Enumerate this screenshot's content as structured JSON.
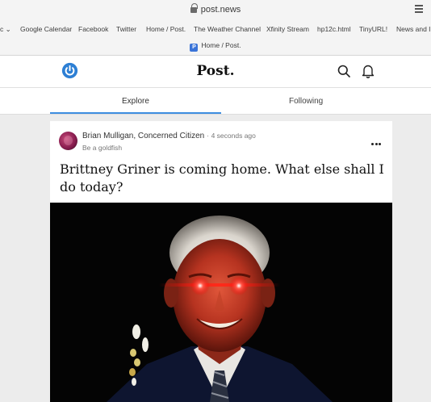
{
  "browser": {
    "url": "post.news",
    "bookmarks": [
      "c ⌄",
      "Google Calendar",
      "Facebook",
      "Twitter",
      "Home / Post.",
      "The Weather Channel",
      "Xfinity Stream",
      "hp12c.html",
      "TinyURL!",
      "News and In"
    ],
    "tab_title": "Home / Post.",
    "tab_favicon": "P"
  },
  "header": {
    "brand": "Post.",
    "left_icon": "power-icon",
    "right_icons": [
      "search-icon",
      "bell-icon"
    ],
    "accent": "#2d7fd4"
  },
  "tabs": [
    {
      "label": "Explore",
      "active": true
    },
    {
      "label": "Following",
      "active": false
    }
  ],
  "post": {
    "author": "Brian Mulligan, Concerned Citizen",
    "separator": "·",
    "time": "4 seconds ago",
    "bio": "Be a goldfish",
    "text": "Brittney Griner is coming home. What else shall I do today?",
    "image_description_icon": "photo-man-laser-eyes"
  }
}
